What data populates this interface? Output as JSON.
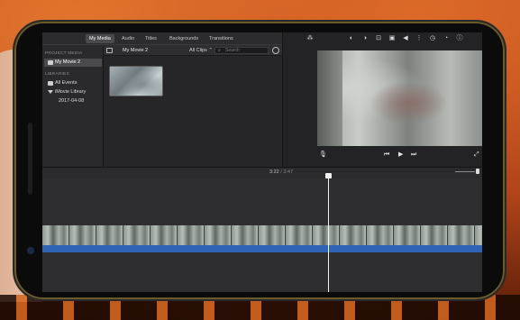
{
  "media_tabs": [
    "My Media",
    "Audio",
    "Titles",
    "Backgrounds",
    "Transitions"
  ],
  "active_tab_index": 0,
  "sidebar": {
    "project_media_heading": "PROJECT MEDIA",
    "project_item": "My Movie 2",
    "libraries_heading": "LIBRARIES",
    "all_events": "All Events",
    "library": "iMovie Library",
    "event_date": "2017-04-08"
  },
  "browser": {
    "title": "My Movie 2",
    "filter": "All Clips",
    "filter_chevron": "⌃",
    "search_placeholder": "Search",
    "search_icon": "⌕"
  },
  "viewer": {
    "tools": [
      "magic-wand-icon",
      "color-balance-icon",
      "color-correction-icon",
      "crop-icon",
      "stabilization-icon",
      "volume-icon",
      "noise-reduction-icon",
      "speed-icon",
      "filter-icon",
      "info-icon"
    ],
    "tool_glyphs": [
      "⁂",
      "◐",
      "◑",
      "⊡",
      "▣",
      "◀",
      "⋮",
      "◷",
      "◔",
      "ⓘ"
    ],
    "mic_glyph": "🎙",
    "prev_glyph": "⏮",
    "play_glyph": "▶",
    "next_glyph": "⏭",
    "fullscreen_glyph": "⤢"
  },
  "timeline": {
    "current_time": "3:22",
    "separator": "/",
    "total_time": "3:47"
  }
}
